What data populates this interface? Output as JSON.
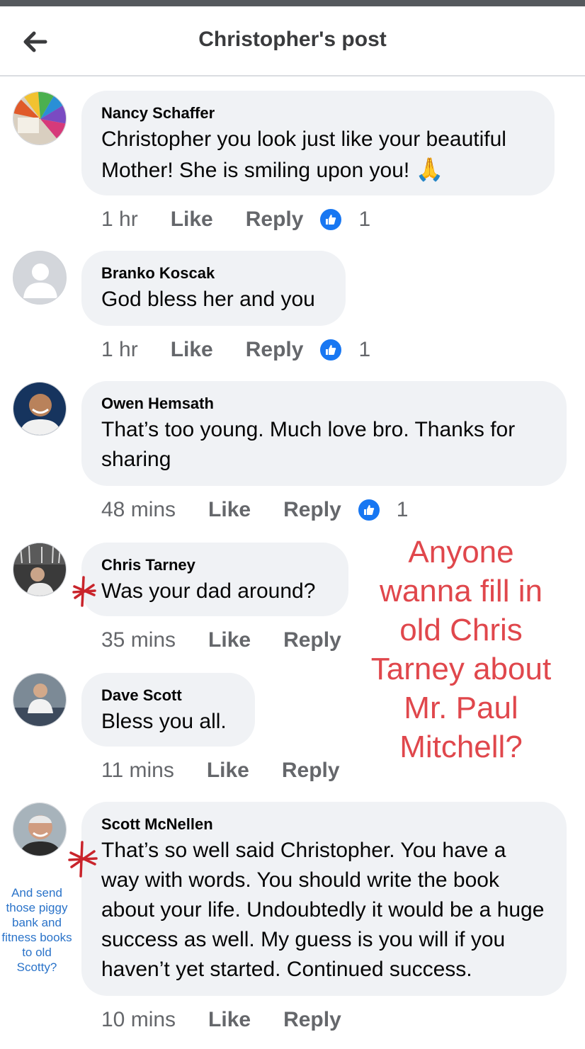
{
  "header": {
    "title": "Christopher's post",
    "back_icon": "arrow-left-icon"
  },
  "comments": [
    {
      "author": "Nancy Schaffer",
      "text": "Christopher you look just like your beautiful Mother!  She is smiling upon you!",
      "emoji": "🙏",
      "time": "1 hr",
      "like": "Like",
      "reply": "Reply",
      "reactions": "1"
    },
    {
      "author": "Branko Koscak",
      "text": "God bless her and you",
      "time": "1 hr",
      "like": "Like",
      "reply": "Reply",
      "reactions": "1"
    },
    {
      "author": "Owen Hemsath",
      "text": "That’s too young. Much love bro. Thanks for sharing",
      "time": "48 mins",
      "like": "Like",
      "reply": "Reply",
      "reactions": "1"
    },
    {
      "author": "Chris Tarney",
      "text": "Was your dad around?",
      "time": "35 mins",
      "like": "Like",
      "reply": "Reply"
    },
    {
      "author": "Dave Scott",
      "text": "Bless you all.",
      "time": "11 mins",
      "like": "Like",
      "reply": "Reply"
    },
    {
      "author": "Scott McNellen",
      "text": "That’s so well said Christopher. You have a way with words. You should write the book about your life. Undoubtedly it would be a huge success as well. My guess is you will if you haven’t yet started. Continued success.",
      "time": "10 mins",
      "like": "Like",
      "reply": "Reply"
    }
  ],
  "annotations": {
    "red_note": "Anyone wanna fill in old Chris Tarney about Mr. Paul Mitchell?",
    "blue_note": "And send those piggy bank and fitness books to old Scotty?"
  },
  "colors": {
    "bubble": "#f0f2f5",
    "meta_text": "#65676b",
    "like_blue": "#1877f2",
    "annotation_red": "#e0474c",
    "annotation_blue": "#2a73c9"
  }
}
